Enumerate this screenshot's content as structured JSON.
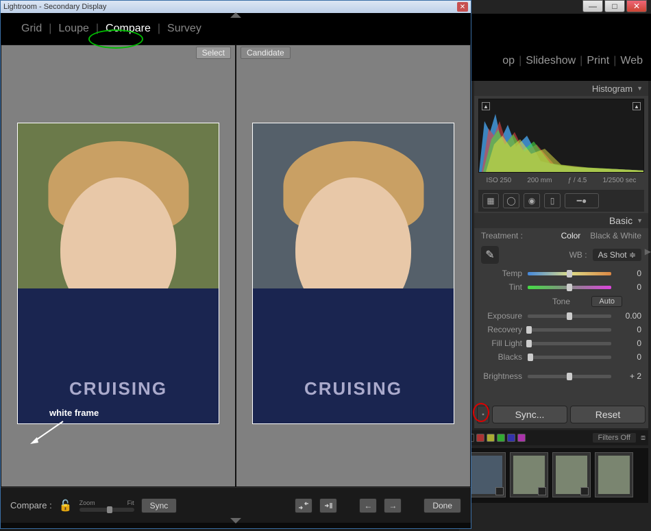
{
  "secondary": {
    "title": "Lightroom - Secondary Display",
    "toolbar": {
      "grid": "Grid",
      "loupe": "Loupe",
      "compare": "Compare",
      "survey": "Survey"
    },
    "columns": {
      "select_label": "Select",
      "candidate_label": "Candidate"
    },
    "photo_text": "CRUISING",
    "annotation_white_frame": "white frame",
    "footer": {
      "label": "Compare :",
      "zoom_label": "Zoom",
      "fit_label": "Fit",
      "sync_btn": "Sync",
      "done_btn": "Done"
    }
  },
  "main": {
    "modules": {
      "develop_suffix": "op",
      "slideshow": "Slideshow",
      "print": "Print",
      "web": "Web"
    },
    "panel": {
      "histogram_title": "Histogram",
      "exif": {
        "iso": "ISO 250",
        "focal": "200 mm",
        "aperture": "ƒ / 4.5",
        "shutter": "1/2500 sec"
      },
      "basic_title": "Basic",
      "treatment_label": "Treatment :",
      "treat_color": "Color",
      "treat_bw": "Black & White",
      "wb_label": "WB :",
      "wb_value": "As Shot",
      "sliders": {
        "temp": {
          "label": "Temp",
          "value": "0",
          "pos": 50
        },
        "tint": {
          "label": "Tint",
          "value": "0",
          "pos": 50
        },
        "exposure": {
          "label": "Exposure",
          "value": "0.00",
          "pos": 50
        },
        "recovery": {
          "label": "Recovery",
          "value": "0",
          "pos": 2
        },
        "filllight": {
          "label": "Fill Light",
          "value": "0",
          "pos": 2
        },
        "blacks": {
          "label": "Blacks",
          "value": "0",
          "pos": 3
        },
        "brightness": {
          "label": "Brightness",
          "value": "+ 2",
          "pos": 50
        }
      },
      "tone_title": "Tone",
      "auto_btn": "Auto",
      "sync_btn": "Sync...",
      "reset_btn": "Reset"
    },
    "filter": {
      "label": "Filters Off"
    }
  }
}
